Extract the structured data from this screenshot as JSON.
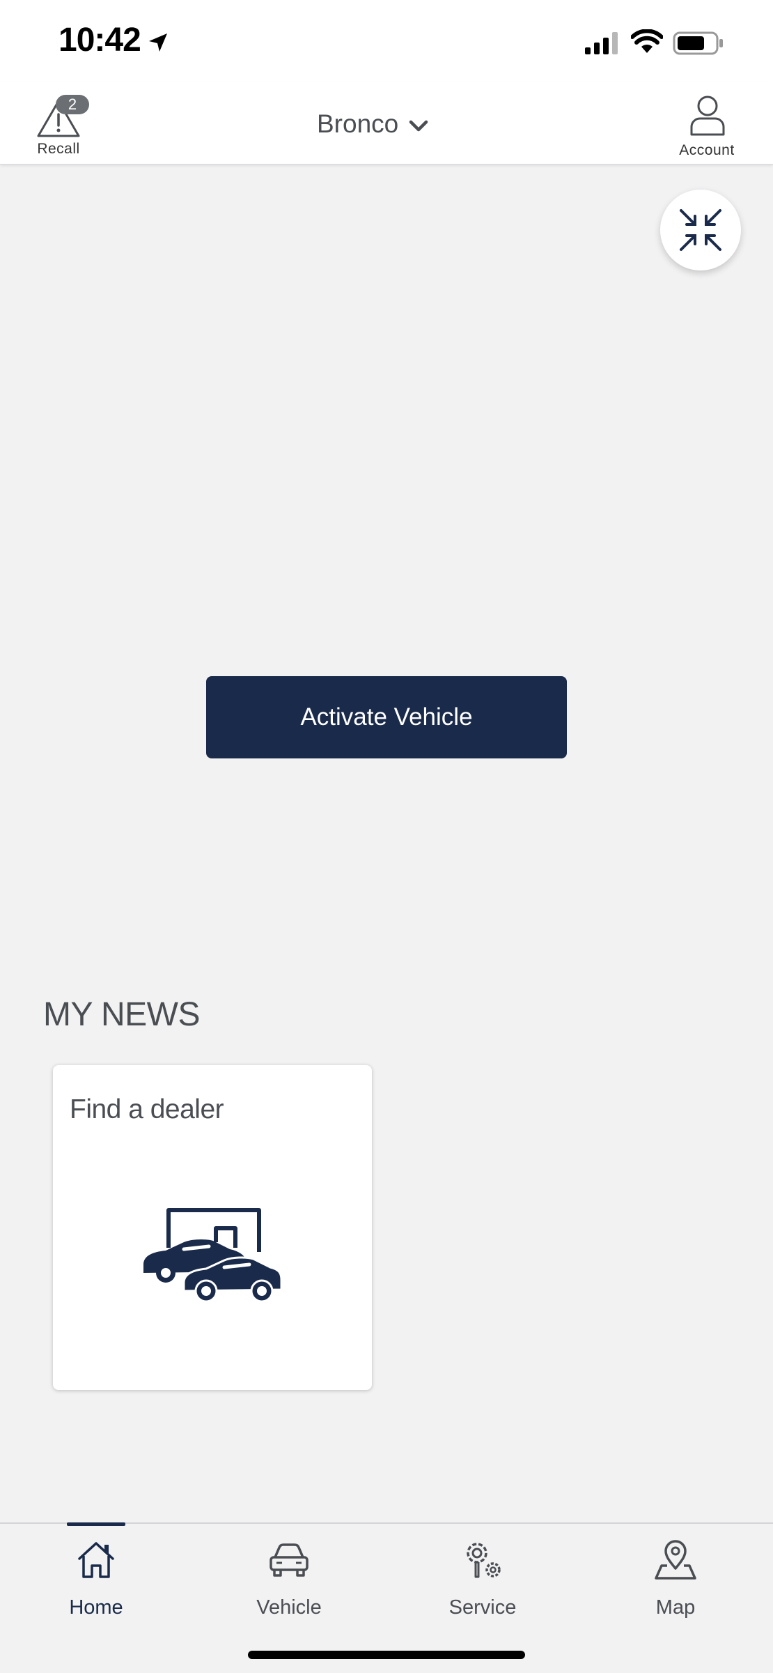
{
  "status_bar": {
    "time": "10:42"
  },
  "header": {
    "recall": {
      "label": "Recall",
      "badge_count": "2"
    },
    "vehicle_selector": {
      "name": "Bronco"
    },
    "account": {
      "label": "Account"
    }
  },
  "main": {
    "activate_button_label": "Activate Vehicle",
    "news": {
      "title": "MY NEWS",
      "cards": [
        {
          "title": "Find a dealer",
          "icon": "dealer-cars-icon"
        }
      ]
    }
  },
  "bottom_nav": {
    "items": [
      {
        "label": "Home",
        "icon": "home-icon",
        "active": true
      },
      {
        "label": "Vehicle",
        "icon": "car-icon",
        "active": false
      },
      {
        "label": "Service",
        "icon": "service-gears-icon",
        "active": false
      },
      {
        "label": "Map",
        "icon": "map-pin-icon",
        "active": false
      }
    ]
  },
  "colors": {
    "primary": "#1a2a4a",
    "background": "#f2f2f3",
    "text": "#4a4d52",
    "badge": "#6b6e72"
  }
}
